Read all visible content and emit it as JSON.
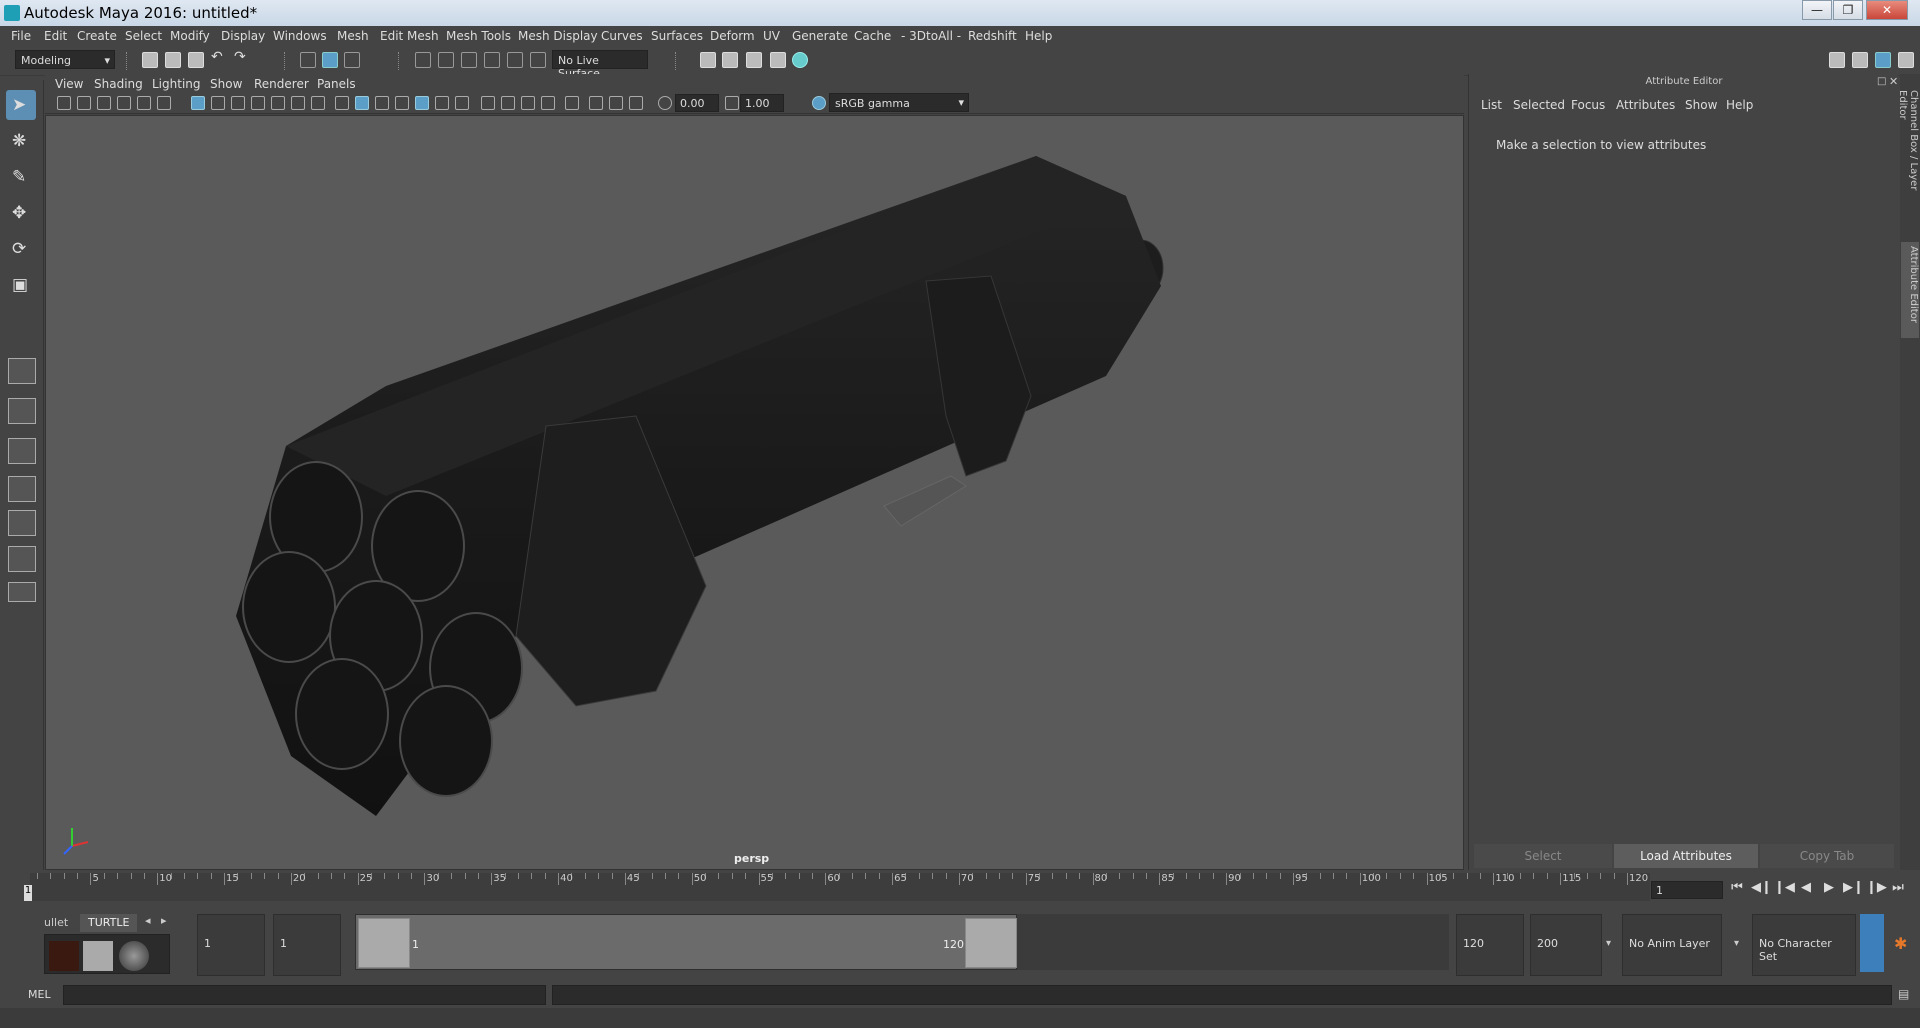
{
  "window": {
    "title": "Autodesk Maya 2016: untitled*",
    "controls": [
      "minimize",
      "restore",
      "close"
    ]
  },
  "menubar": [
    "File",
    "Edit",
    "Create",
    "Select",
    "Modify",
    "Display",
    "Windows",
    "Mesh",
    "Edit Mesh",
    "Mesh Tools",
    "Mesh Display",
    "Curves",
    "Surfaces",
    "Deform",
    "UV",
    "Generate",
    "Cache",
    "- 3DtoAll -",
    "Redshift",
    "Help"
  ],
  "toolbar": {
    "menuset": "Modeling",
    "live_surface": "No Live Surface"
  },
  "viewport": {
    "menu": [
      "View",
      "Shading",
      "Lighting",
      "Show",
      "Renderer",
      "Panels"
    ],
    "exposure": "0.00",
    "gamma": "1.00",
    "color_space": "sRGB gamma",
    "camera_label": "persp"
  },
  "attribute_editor": {
    "title": "Attribute Editor",
    "menu": [
      "List",
      "Selected",
      "Focus",
      "Attributes",
      "Show",
      "Help"
    ],
    "message": "Make a selection to view attributes",
    "buttons": [
      "Select",
      "Load Attributes",
      "Copy Tab"
    ],
    "side_tabs": [
      "Channel Box / Layer Editor",
      "Attribute Editor"
    ]
  },
  "timeline": {
    "ticks": [
      "5",
      "10",
      "15",
      "20",
      "25",
      "30",
      "35",
      "40",
      "45",
      "50",
      "55",
      "60",
      "65",
      "70",
      "75",
      "80",
      "85",
      "90",
      "95",
      "100",
      "105",
      "110",
      "115",
      "120"
    ],
    "current_frame": "1",
    "frame_field": "1"
  },
  "range": {
    "shelf_tabs": [
      "ullet",
      "TURTLE"
    ],
    "start_time": "1",
    "playback_start": "1",
    "range_start": "1",
    "range_end": "120",
    "playback_end": "120",
    "end_time": "200",
    "anim_layer": "No Anim Layer",
    "character_set": "No Character Set"
  },
  "command_line": {
    "label": "MEL"
  },
  "colors": {
    "accent": "#5d8eb3",
    "viewport_bg": "#5a5a5a",
    "panel_bg": "#444444"
  }
}
